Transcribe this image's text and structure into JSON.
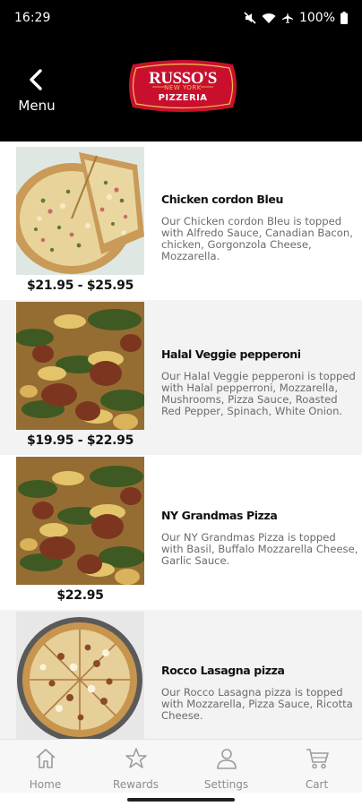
{
  "status_bar": {
    "time": "16:29",
    "battery": "100%",
    "icons": [
      "mute-icon",
      "wifi-icon",
      "airplane-icon",
      "battery-icon"
    ]
  },
  "header": {
    "back_label": "Menu",
    "logo": {
      "line1": "RUSSO'S",
      "line2": "NEW YORK",
      "line3": "PIZZERIA",
      "colors": {
        "red": "#c8102e",
        "gold": "#f2c14e"
      }
    }
  },
  "menu": {
    "items": [
      {
        "name": "Chicken cordon Bleu",
        "description": "Our Chicken cordon Bleu is topped with Alfredo Sauce, Canadian Bacon, chicken, Gorgonzola Cheese, Mozzarella.",
        "price": "$21.95 - $25.95"
      },
      {
        "name": "Halal Veggie pepperoni",
        "description": "Our Halal Veggie pepperoni is topped with Halal pepperroni, Mozzarella, Mushrooms, Pizza Sauce, Roasted Red Pepper, Spinach, White Onion.",
        "price": "$19.95 - $22.95"
      },
      {
        "name": "NY Grandmas Pizza",
        "description": "Our NY Grandmas Pizza is topped with Basil, Buffalo Mozzarella Cheese, Garlic Sauce.",
        "price": "$22.95"
      },
      {
        "name": "Rocco Lasagna pizza",
        "description": "Our Rocco Lasagna pizza is topped with Mozzarella, Pizza Sauce, Ricotta Cheese.",
        "price": ""
      }
    ]
  },
  "bottom_nav": {
    "items": [
      {
        "label": "Home",
        "icon": "home-icon"
      },
      {
        "label": "Rewards",
        "icon": "star-icon"
      },
      {
        "label": "Settings",
        "icon": "person-icon"
      },
      {
        "label": "Cart",
        "icon": "cart-icon"
      }
    ]
  }
}
